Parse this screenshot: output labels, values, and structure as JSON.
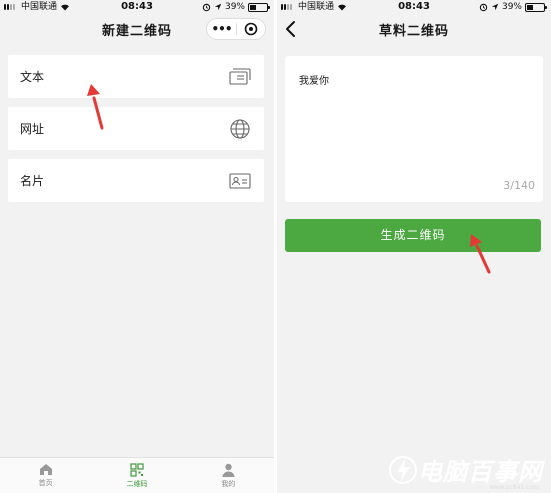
{
  "left_screen": {
    "status": {
      "carrier": "中国联通",
      "time": "08:43",
      "battery": "39%",
      "battery_level": 0.39
    },
    "title": "新建二维码",
    "capsule": {
      "more": "•••"
    },
    "menu": [
      {
        "label": "文本",
        "icon": "text-card-icon"
      },
      {
        "label": "网址",
        "icon": "globe-icon"
      },
      {
        "label": "名片",
        "icon": "contact-card-icon"
      }
    ],
    "tabs": [
      {
        "label": "首页",
        "icon": "home-icon",
        "active": false
      },
      {
        "label": "二维码",
        "icon": "qr-code-icon",
        "active": true
      },
      {
        "label": "我的",
        "icon": "person-icon",
        "active": false
      }
    ]
  },
  "right_screen": {
    "status": {
      "carrier": "中国联通",
      "time": "08:43",
      "battery": "39%",
      "battery_level": 0.39
    },
    "title": "草料二维码",
    "input_value": "我爱你",
    "counter": "3/140",
    "button_label": "生成二维码"
  },
  "watermark": {
    "text": "电脑百事网",
    "url": "www.pc841.com"
  },
  "colors": {
    "accent": "#4ca840",
    "arrow": "#e53935",
    "background": "#f2f2f2"
  }
}
